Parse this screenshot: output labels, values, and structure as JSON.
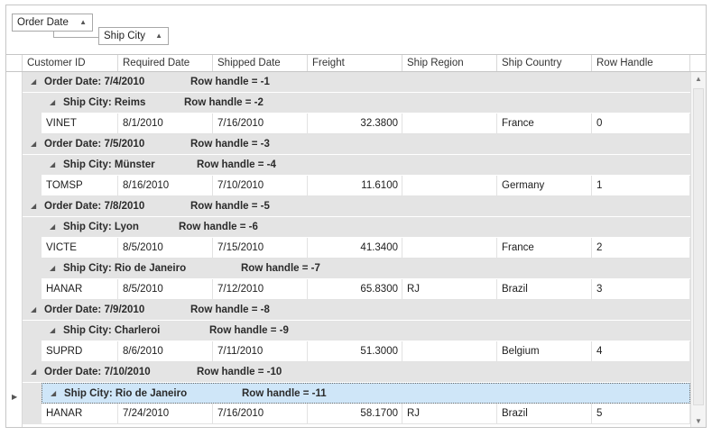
{
  "group_panel": {
    "groups": [
      {
        "label": "Order Date",
        "sort_icon": "sort-ascending-icon"
      },
      {
        "label": "Ship City",
        "sort_icon": "sort-ascending-icon"
      }
    ]
  },
  "columns": [
    "Customer ID",
    "Required Date",
    "Shipped Date",
    "Freight",
    "Ship Region",
    "Ship Country",
    "Row Handle"
  ],
  "rows": [
    {
      "type": "group",
      "level": 1,
      "text": "Order Date: 7/4/2010",
      "handle": "Row handle = -1"
    },
    {
      "type": "group",
      "level": 2,
      "text": "Ship City: Reims",
      "handle": "Row handle = -2"
    },
    {
      "type": "data",
      "cells": [
        "VINET",
        "8/1/2010",
        "7/16/2010",
        "32.3800",
        "",
        "France",
        "0"
      ]
    },
    {
      "type": "group",
      "level": 1,
      "text": "Order Date: 7/5/2010",
      "handle": "Row handle = -3"
    },
    {
      "type": "group",
      "level": 2,
      "text": "Ship City: Münster",
      "handle": "Row handle = -4"
    },
    {
      "type": "data",
      "cells": [
        "TOMSP",
        "8/16/2010",
        "7/10/2010",
        "11.6100",
        "",
        "Germany",
        "1"
      ]
    },
    {
      "type": "group",
      "level": 1,
      "text": "Order Date: 7/8/2010",
      "handle": "Row handle = -5"
    },
    {
      "type": "group",
      "level": 2,
      "text": "Ship City: Lyon",
      "handle": "Row handle = -6"
    },
    {
      "type": "data",
      "cells": [
        "VICTE",
        "8/5/2010",
        "7/15/2010",
        "41.3400",
        "",
        "France",
        "2"
      ]
    },
    {
      "type": "group",
      "level": 2,
      "text": "Ship City: Rio de Janeiro",
      "handle": "Row handle = -7"
    },
    {
      "type": "data",
      "cells": [
        "HANAR",
        "8/5/2010",
        "7/12/2010",
        "65.8300",
        "RJ",
        "Brazil",
        "3"
      ]
    },
    {
      "type": "group",
      "level": 1,
      "text": "Order Date: 7/9/2010",
      "handle": "Row handle = -8"
    },
    {
      "type": "group",
      "level": 2,
      "text": "Ship City: Charleroi",
      "handle": "Row handle = -9"
    },
    {
      "type": "data",
      "cells": [
        "SUPRD",
        "8/6/2010",
        "7/11/2010",
        "51.3000",
        "",
        "Belgium",
        "4"
      ]
    },
    {
      "type": "group",
      "level": 1,
      "text": "Order Date: 7/10/2010",
      "handle": "Row handle = -10"
    },
    {
      "type": "group",
      "level": 2,
      "text": "Ship City: Rio de Janeiro",
      "handle": "Row handle = -11",
      "focused": true
    },
    {
      "type": "data",
      "cells": [
        "HANAR",
        "7/24/2010",
        "7/16/2010",
        "58.1700",
        "RJ",
        "Brazil",
        "5"
      ]
    }
  ],
  "colors": {
    "group_row": "#e4e4e4",
    "focused_row": "#cfe6f8"
  }
}
